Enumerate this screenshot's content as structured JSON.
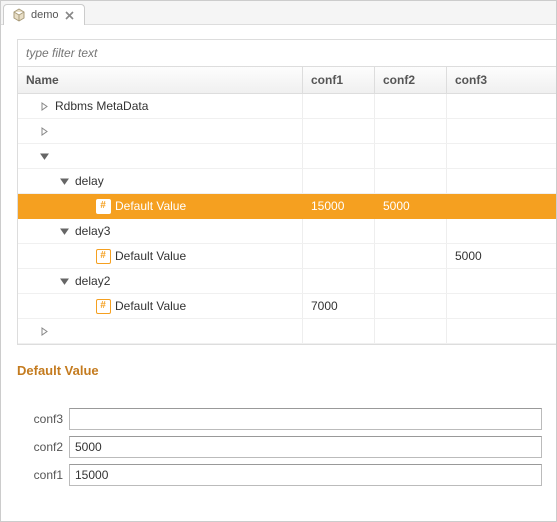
{
  "tab": {
    "label": "demo"
  },
  "filter": {
    "placeholder": "type filter text"
  },
  "columns": {
    "name": "Name",
    "c1": "conf1",
    "c2": "conf2",
    "c3": "conf3"
  },
  "rows": [
    {
      "indent": 14,
      "expand": "right",
      "label": "Rdbms MetaData",
      "icon": "",
      "c1": "",
      "c2": "",
      "c3": "",
      "selected": false
    },
    {
      "indent": 14,
      "expand": "right",
      "label": "",
      "icon": "",
      "c1": "",
      "c2": "",
      "c3": "",
      "selected": false
    },
    {
      "indent": 14,
      "expand": "down",
      "label": "",
      "icon": "",
      "c1": "",
      "c2": "",
      "c3": "",
      "selected": false
    },
    {
      "indent": 34,
      "expand": "down",
      "label": "delay",
      "icon": "",
      "c1": "",
      "c2": "",
      "c3": "",
      "selected": false
    },
    {
      "indent": 54,
      "expand": "none",
      "label": "Default Value",
      "icon": "hash",
      "c1": "15000",
      "c2": "5000",
      "c3": "",
      "selected": true
    },
    {
      "indent": 34,
      "expand": "down",
      "label": "delay3",
      "icon": "",
      "c1": "",
      "c2": "",
      "c3": "",
      "selected": false
    },
    {
      "indent": 54,
      "expand": "none",
      "label": "Default Value",
      "icon": "hash",
      "c1": "",
      "c2": "",
      "c3": "5000",
      "selected": false
    },
    {
      "indent": 34,
      "expand": "down",
      "label": "delay2",
      "icon": "",
      "c1": "",
      "c2": "",
      "c3": "",
      "selected": false
    },
    {
      "indent": 54,
      "expand": "none",
      "label": "Default Value",
      "icon": "hash",
      "c1": "7000",
      "c2": "",
      "c3": "",
      "selected": false
    },
    {
      "indent": 14,
      "expand": "right",
      "label": "",
      "icon": "",
      "c1": "",
      "c2": "",
      "c3": "",
      "selected": false
    }
  ],
  "detail": {
    "title": "Default Value",
    "fields": [
      {
        "label": "conf3",
        "value": ""
      },
      {
        "label": "conf2",
        "value": "5000"
      },
      {
        "label": "conf1",
        "value": "15000"
      }
    ]
  }
}
